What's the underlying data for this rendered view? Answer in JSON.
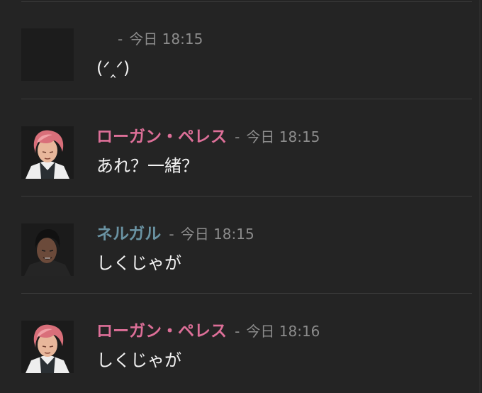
{
  "messages": [
    {
      "author": "",
      "author_color": "#dd6f98",
      "separator": "-",
      "time": "今日 18:15",
      "text": "(ᐟ‸ᐟ)",
      "avatar_icon": "blank-avatar-icon"
    },
    {
      "author": "ローガン・ペレス",
      "author_color": "#dd6f98",
      "separator": "-",
      "time": "今日 18:15",
      "text": "あれ？一緒？",
      "avatar_icon": "pink-hair-man-avatar-icon"
    },
    {
      "author": "ネルガル",
      "author_color": "#6a93a3",
      "separator": "-",
      "time": "今日 18:15",
      "text": "しくじゃが",
      "avatar_icon": "dark-skin-man-avatar-icon"
    },
    {
      "author": "ローガン・ペレス",
      "author_color": "#dd6f98",
      "separator": "-",
      "time": "今日 18:16",
      "text": "しくじゃが",
      "avatar_icon": "pink-hair-man-avatar-icon"
    }
  ],
  "colors": {
    "background": "#242424",
    "divider": "#3c3c3c",
    "timestamp": "#8c8c8c",
    "message_text": "#f2f2f2"
  }
}
